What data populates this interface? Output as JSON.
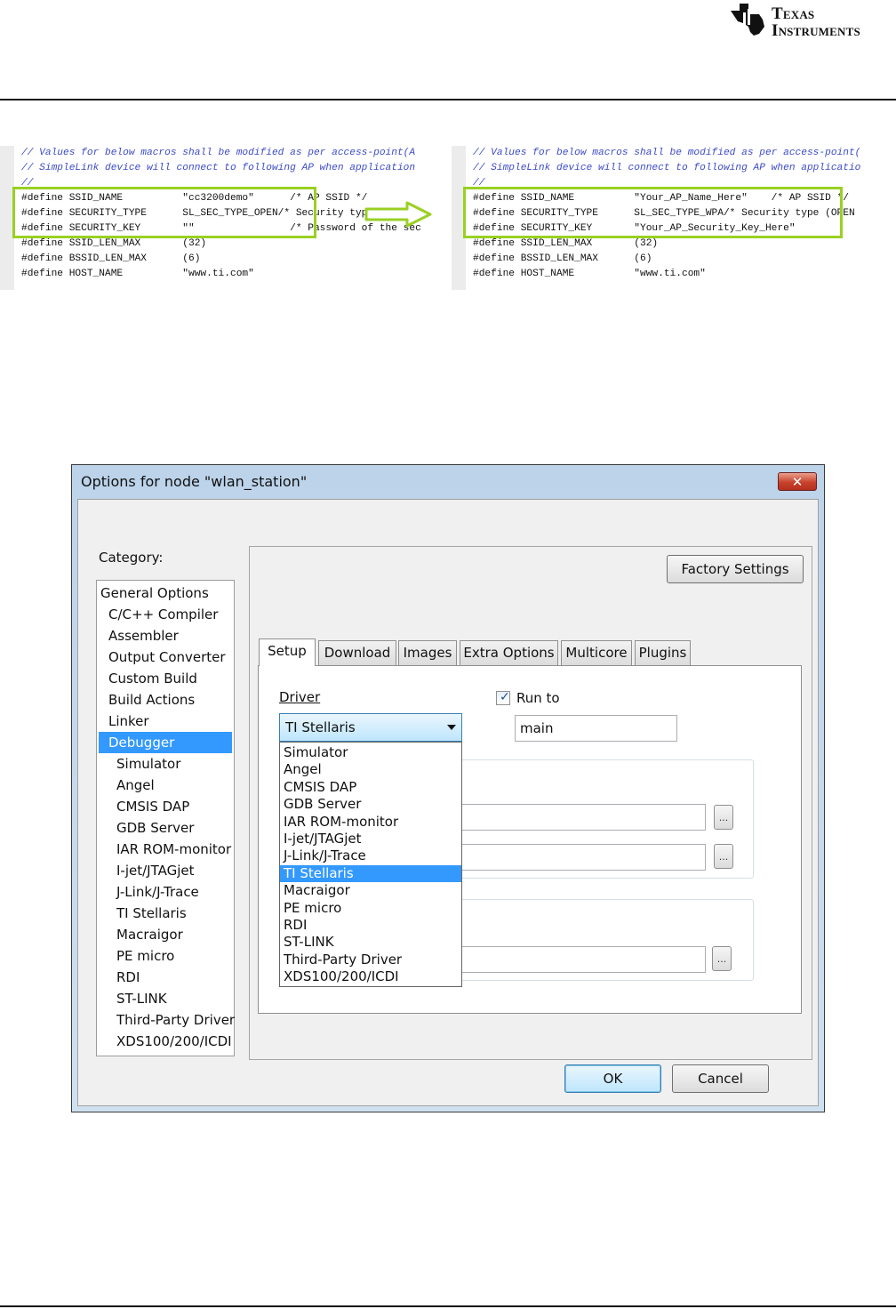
{
  "header": {
    "logo_line1": "Texas",
    "logo_line2": "Instruments"
  },
  "code_before": {
    "lines": [
      "// Values for below macros shall be modified as per access-point(A",
      "// SimpleLink device will connect to following AP when application",
      "//",
      "#define SSID_NAME          \"cc3200demo\"      /* AP SSID */",
      "#define SECURITY_TYPE      SL_SEC_TYPE_OPEN/* Security type (OPEN",
      "#define SECURITY_KEY       \"\"                /* Password of the sec",
      "#define SSID_LEN_MAX       (32)",
      "#define BSSID_LEN_MAX      (6)",
      "#define HOST_NAME          \"www.ti.com\""
    ]
  },
  "code_after": {
    "lines": [
      "// Values for below macros shall be modified as per access-point(",
      "// SimpleLink device will connect to following AP when applicatio",
      "//",
      "#define SSID_NAME          \"Your_AP_Name_Here\"    /* AP SSID */",
      "#define SECURITY_TYPE      SL_SEC_TYPE_WPA/* Security type (OPEN",
      "#define SECURITY_KEY       \"Your_AP_Security_Key_Here\"",
      "#define SSID_LEN_MAX       (32)",
      "#define BSSID_LEN_MAX      (6)",
      "#define HOST_NAME          \"www.ti.com\""
    ]
  },
  "dialog": {
    "title": "Options for node \"wlan_station\"",
    "close_label": "✕",
    "category_label": "Category:",
    "categories": [
      "General Options",
      "C/C++ Compiler",
      "Assembler",
      "Output Converter",
      "Custom Build",
      "Build Actions",
      "Linker",
      "Debugger",
      "Simulator",
      "Angel",
      "CMSIS DAP",
      "GDB Server",
      "IAR ROM-monitor",
      "I-jet/JTAGjet",
      "J-Link/J-Trace",
      "TI Stellaris",
      "Macraigor",
      "PE micro",
      "RDI",
      "ST-LINK",
      "Third-Party Driver",
      "XDS100/200/ICDI"
    ],
    "selected_category": "Debugger",
    "factory_settings_label": "Factory Settings",
    "tabs": [
      "Setup",
      "Download",
      "Images",
      "Extra Options",
      "Multicore",
      "Plugins"
    ],
    "active_tab": "Setup",
    "driver_label": "Driver",
    "driver_value": "TI Stellaris",
    "driver_options": [
      "Simulator",
      "Angel",
      "CMSIS DAP",
      "GDB Server",
      "IAR ROM-monitor",
      "I-jet/JTAGjet",
      "J-Link/J-Trace",
      "TI Stellaris",
      "Macraigor",
      "PE micro",
      "RDI",
      "ST-LINK",
      "Third-Party Driver",
      "XDS100/200/ICDI"
    ],
    "run_to_label": "Run to",
    "run_to_checked": true,
    "run_to_value": "main",
    "browse_label": "...",
    "ok_label": "OK",
    "cancel_label": "Cancel"
  }
}
